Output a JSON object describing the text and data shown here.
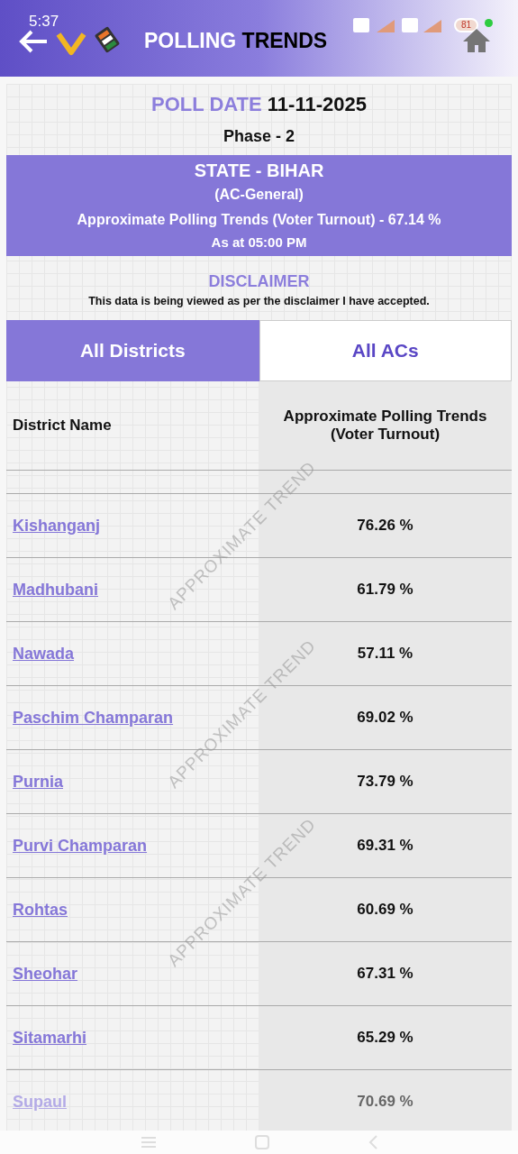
{
  "status_bar": {
    "time": "5:37",
    "battery": "81"
  },
  "header": {
    "title_lead": "POLLING",
    "title_rest": "TRENDS"
  },
  "poll": {
    "label": "POLL DATE",
    "date": "11-11-2025",
    "phase": "Phase - 2"
  },
  "banner": {
    "state": "STATE - BIHAR",
    "type": "(AC-General)",
    "turnout": "Approximate Polling Trends (Voter Turnout) - 67.14 %",
    "as_at": "As at 05:00 PM"
  },
  "disclaimer": {
    "title": "DISCLAIMER",
    "text": "This data is being viewed as per the disclaimer I have accepted."
  },
  "tabs": [
    {
      "label": "All Districts",
      "selected": true
    },
    {
      "label": "All ACs",
      "selected": false
    }
  ],
  "table": {
    "columns": [
      "District Name",
      "Approximate Polling Trends (Voter Turnout)"
    ],
    "rows": [
      {
        "district": "Kishanganj",
        "turnout": "76.26 %"
      },
      {
        "district": "Madhubani",
        "turnout": "61.79 %"
      },
      {
        "district": "Nawada",
        "turnout": "57.11 %"
      },
      {
        "district": "Paschim Champaran",
        "turnout": "69.02 %"
      },
      {
        "district": "Purnia",
        "turnout": "73.79 %"
      },
      {
        "district": "Purvi Champaran",
        "turnout": "69.31 %"
      },
      {
        "district": "Rohtas",
        "turnout": "60.69 %"
      },
      {
        "district": "Sheohar",
        "turnout": "67.31 %"
      },
      {
        "district": "Sitamarhi",
        "turnout": "65.29 %"
      },
      {
        "district": "Supaul",
        "turnout": "70.69 %"
      }
    ]
  },
  "watermarks": [
    "APPROXIMATE TREND",
    "APPROXIMATE TREND",
    "APPROXIMATE TREND"
  ]
}
